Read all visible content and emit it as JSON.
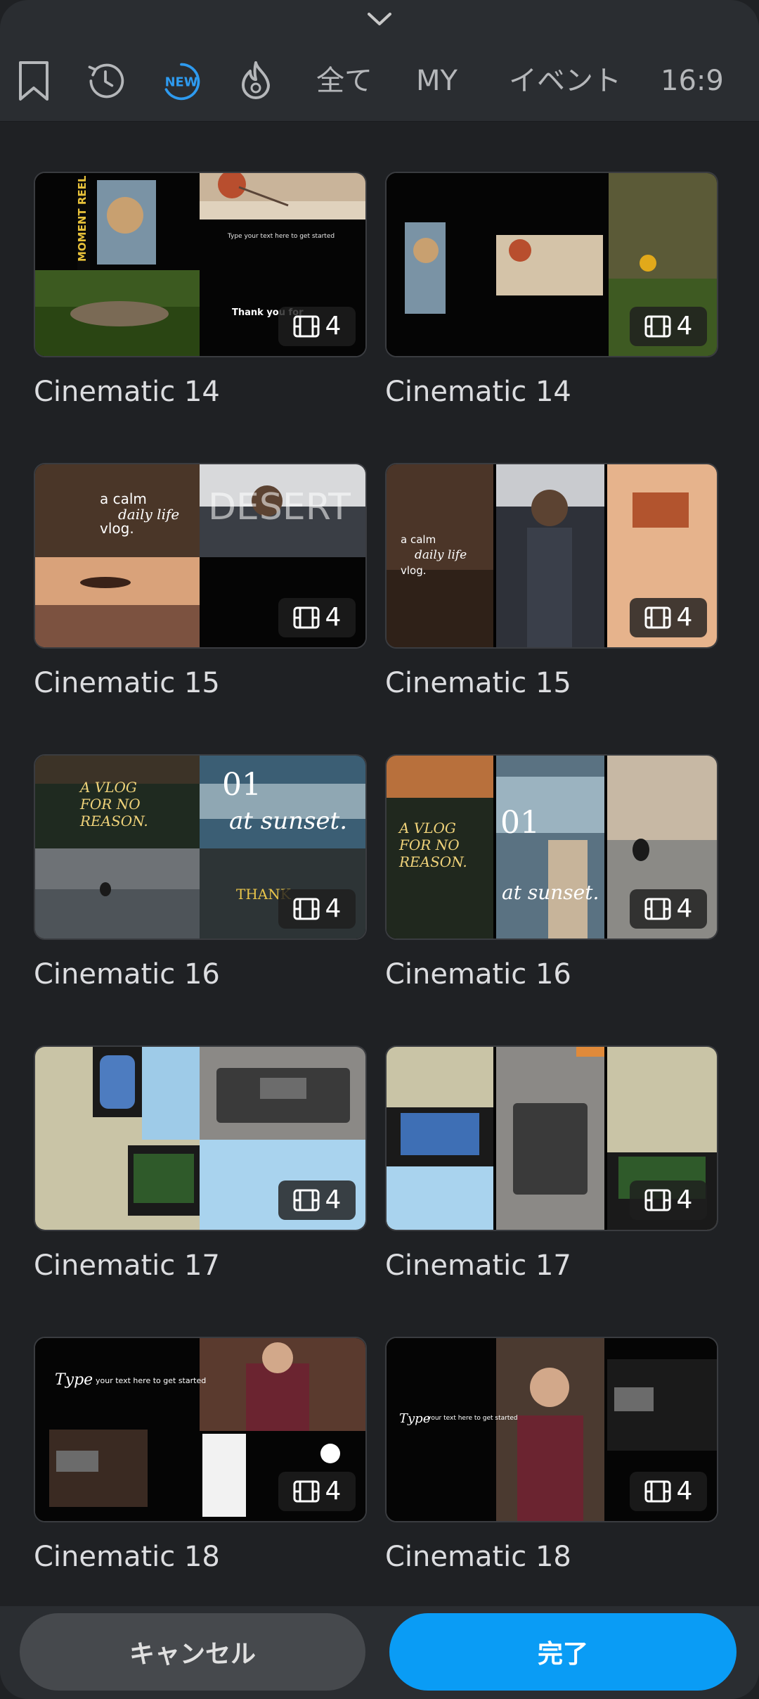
{
  "tabs": {
    "icons": [
      {
        "name": "bookmark-icon"
      },
      {
        "name": "history-icon"
      },
      {
        "name": "new-badge-icon",
        "label": "NEW",
        "color": "#2e9bf0"
      },
      {
        "name": "fire-icon"
      }
    ],
    "text_tabs": [
      "全て",
      "MY",
      "イベント",
      "16:9"
    ]
  },
  "templates": [
    {
      "title": "Cinematic 14",
      "count": "4"
    },
    {
      "title": "Cinematic 14",
      "count": "4"
    },
    {
      "title": "Cinematic 15",
      "count": "4"
    },
    {
      "title": "Cinematic 15",
      "count": "4"
    },
    {
      "title": "Cinematic 16",
      "count": "4"
    },
    {
      "title": "Cinematic 16",
      "count": "4"
    },
    {
      "title": "Cinematic 17",
      "count": "4"
    },
    {
      "title": "Cinematic 17",
      "count": "4"
    },
    {
      "title": "Cinematic 18",
      "count": "4"
    },
    {
      "title": "Cinematic 18",
      "count": "4"
    }
  ],
  "thumb_text": {
    "moment_reel": "MOMENT REEL",
    "type_prompt": "Type your text here to get started",
    "thank_you": "Thank you for",
    "calm_line1": "a calm",
    "calm_line2": "daily life",
    "calm_line3": "vlog.",
    "desert": "DESERT",
    "vlog_line1": "A VLOG",
    "vlog_line2": "FOR NO",
    "vlog_line3": "REASON.",
    "number": "01",
    "sunset": "at sunset.",
    "thank": "THANK",
    "type_word": "Type",
    "your_text": "your text here to get started"
  },
  "buttons": {
    "cancel": "キャンセル",
    "done": "完了"
  },
  "colors": {
    "accent": "#0a9cf5",
    "panel": "#2a2d31",
    "background": "#1f2124"
  }
}
